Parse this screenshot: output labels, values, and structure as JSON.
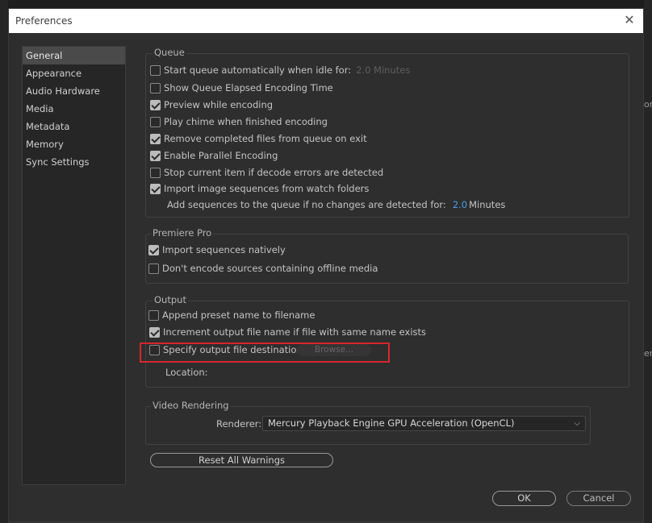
{
  "window": {
    "title": "Preferences"
  },
  "background": {
    "right_fragment": "or",
    "right_fragment2": "er"
  },
  "sidebar": {
    "items": [
      {
        "label": "General",
        "active": true
      },
      {
        "label": "Appearance"
      },
      {
        "label": "Audio Hardware"
      },
      {
        "label": "Media"
      },
      {
        "label": "Metadata"
      },
      {
        "label": "Memory"
      },
      {
        "label": "Sync Settings"
      }
    ]
  },
  "queue": {
    "title": "Queue",
    "items": [
      {
        "label": "Start queue automatically when idle for:",
        "checked": false,
        "suffix": "2.0 Minutes"
      },
      {
        "label": "Show Queue Elapsed Encoding Time",
        "checked": false
      },
      {
        "label": "Preview while encoding",
        "checked": true
      },
      {
        "label": "Play chime when finished encoding",
        "checked": false
      },
      {
        "label": "Remove completed files from queue on exit",
        "checked": true
      },
      {
        "label": "Enable Parallel Encoding",
        "checked": true
      },
      {
        "label": "Stop current item if decode errors are detected",
        "checked": false
      },
      {
        "label": "Import image sequences from watch folders",
        "checked": true
      }
    ],
    "add_sequences_label": "Add sequences to the queue if no changes are detected for:",
    "add_sequences_value": "2.0",
    "add_sequences_unit": "Minutes"
  },
  "premiere": {
    "title": "Premiere Pro",
    "items": [
      {
        "label": "Import sequences natively",
        "checked": true
      },
      {
        "label": "Don't encode sources containing offline media",
        "checked": false
      }
    ]
  },
  "output": {
    "title": "Output",
    "items": [
      {
        "label": "Append preset name to filename",
        "checked": false
      },
      {
        "label": "Increment output file name if file with same name exists",
        "checked": true
      },
      {
        "label": "Specify output file destination:",
        "checked": false
      }
    ],
    "browse_label": "Browse...",
    "location_label": "Location:"
  },
  "video_rendering": {
    "title": "Video Rendering",
    "renderer_label": "Renderer:",
    "renderer_value": "Mercury Playback Engine GPU Acceleration (OpenCL)"
  },
  "buttons": {
    "reset_warnings": "Reset All Warnings",
    "ok": "OK",
    "cancel": "Cancel"
  },
  "colors": {
    "highlight_box": "#d6262d",
    "accent_value": "#4a9ee8"
  }
}
